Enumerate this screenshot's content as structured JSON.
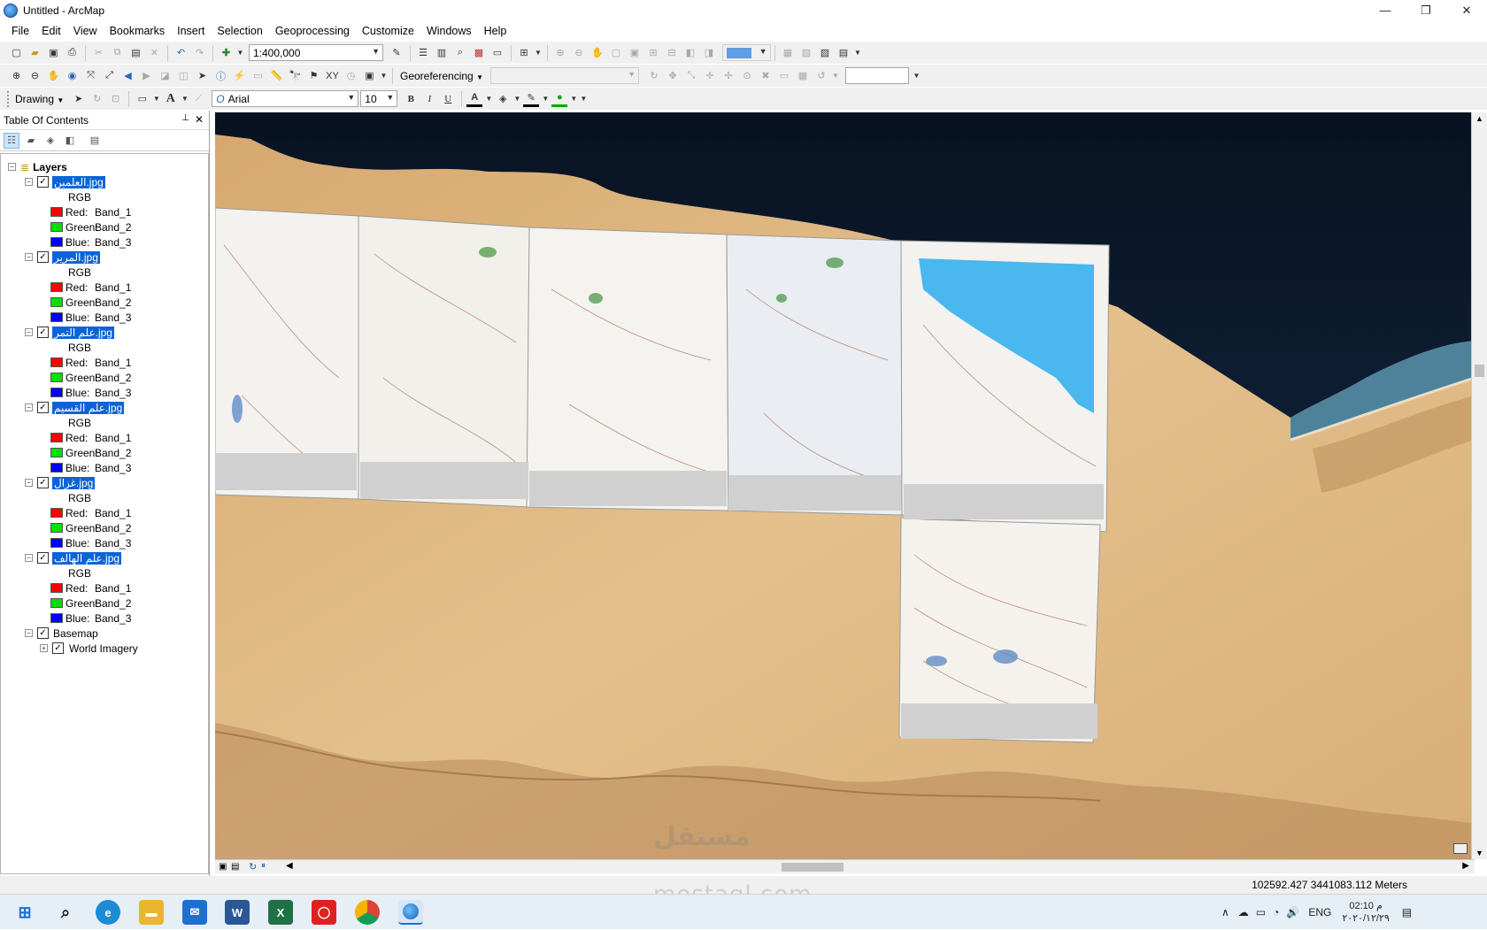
{
  "window": {
    "title": "Untitled - ArcMap",
    "controls": [
      "—",
      "❐",
      "✕"
    ]
  },
  "menu": [
    "File",
    "Edit",
    "View",
    "Bookmarks",
    "Insert",
    "Selection",
    "Geoprocessing",
    "Customize",
    "Windows",
    "Help"
  ],
  "toolbar": {
    "scale": "1:400,000",
    "georeferencing_label": "Georeferencing",
    "drawing_label": "Drawing",
    "font_name": "Arial",
    "font_size": "10",
    "bold": "B",
    "italic": "I",
    "underline": "U",
    "text_tool": "A"
  },
  "toc": {
    "title": "Table Of Contents",
    "pin": "📌",
    "close": "✕",
    "root": "Layers",
    "layers": [
      {
        "name": "العلمين.jpg",
        "type": "RGB",
        "bands": [
          {
            "label": "Red:",
            "band": "Band_1"
          },
          {
            "label": "Green:",
            "band": "Band_2"
          },
          {
            "label": "Blue:",
            "band": "Band_3"
          }
        ]
      },
      {
        "name": "المرير.jpg",
        "type": "RGB",
        "bands": [
          {
            "label": "Red:",
            "band": "Band_1"
          },
          {
            "label": "Green:",
            "band": "Band_2"
          },
          {
            "label": "Blue:",
            "band": "Band_3"
          }
        ]
      },
      {
        "name": "علم التمر.jpg",
        "type": "RGB",
        "bands": [
          {
            "label": "Red:",
            "band": "Band_1"
          },
          {
            "label": "Green:",
            "band": "Band_2"
          },
          {
            "label": "Blue:",
            "band": "Band_3"
          }
        ]
      },
      {
        "name": "علم القسيم.jpg",
        "type": "RGB",
        "bands": [
          {
            "label": "Red:",
            "band": "Band_1"
          },
          {
            "label": "Green:",
            "band": "Band_2"
          },
          {
            "label": "Blue:",
            "band": "Band_3"
          }
        ]
      },
      {
        "name": "غزال.jpg",
        "type": "RGB",
        "bands": [
          {
            "label": "Red:",
            "band": "Band_1"
          },
          {
            "label": "Green:",
            "band": "Band_2"
          },
          {
            "label": "Blue:",
            "band": "Band_3"
          }
        ]
      },
      {
        "name": "علم الهالف.jpg",
        "type": "RGB",
        "bands": [
          {
            "label": "Red:",
            "band": "Band_1"
          },
          {
            "label": "Green:",
            "band": "Band_2"
          },
          {
            "label": "Blue:",
            "band": "Band_3"
          }
        ]
      }
    ],
    "basemap": {
      "name": "Basemap",
      "child": "World Imagery"
    }
  },
  "status": {
    "coordinates": "102592.427  3441083.112 Meters"
  },
  "taskbar": {
    "lang": "ENG",
    "time": "02:10 م",
    "date": "٢٠٢٠/١٢/٢٩"
  },
  "watermark": {
    "line1": "مستقل",
    "line2": "mostaql.com"
  },
  "colors": {
    "selection": "#0a64d6",
    "red_band": "#ff0000",
    "green_band": "#00e000",
    "blue_band": "#0000ff",
    "sea": "#0b1626",
    "desert": "#e2bd86"
  }
}
